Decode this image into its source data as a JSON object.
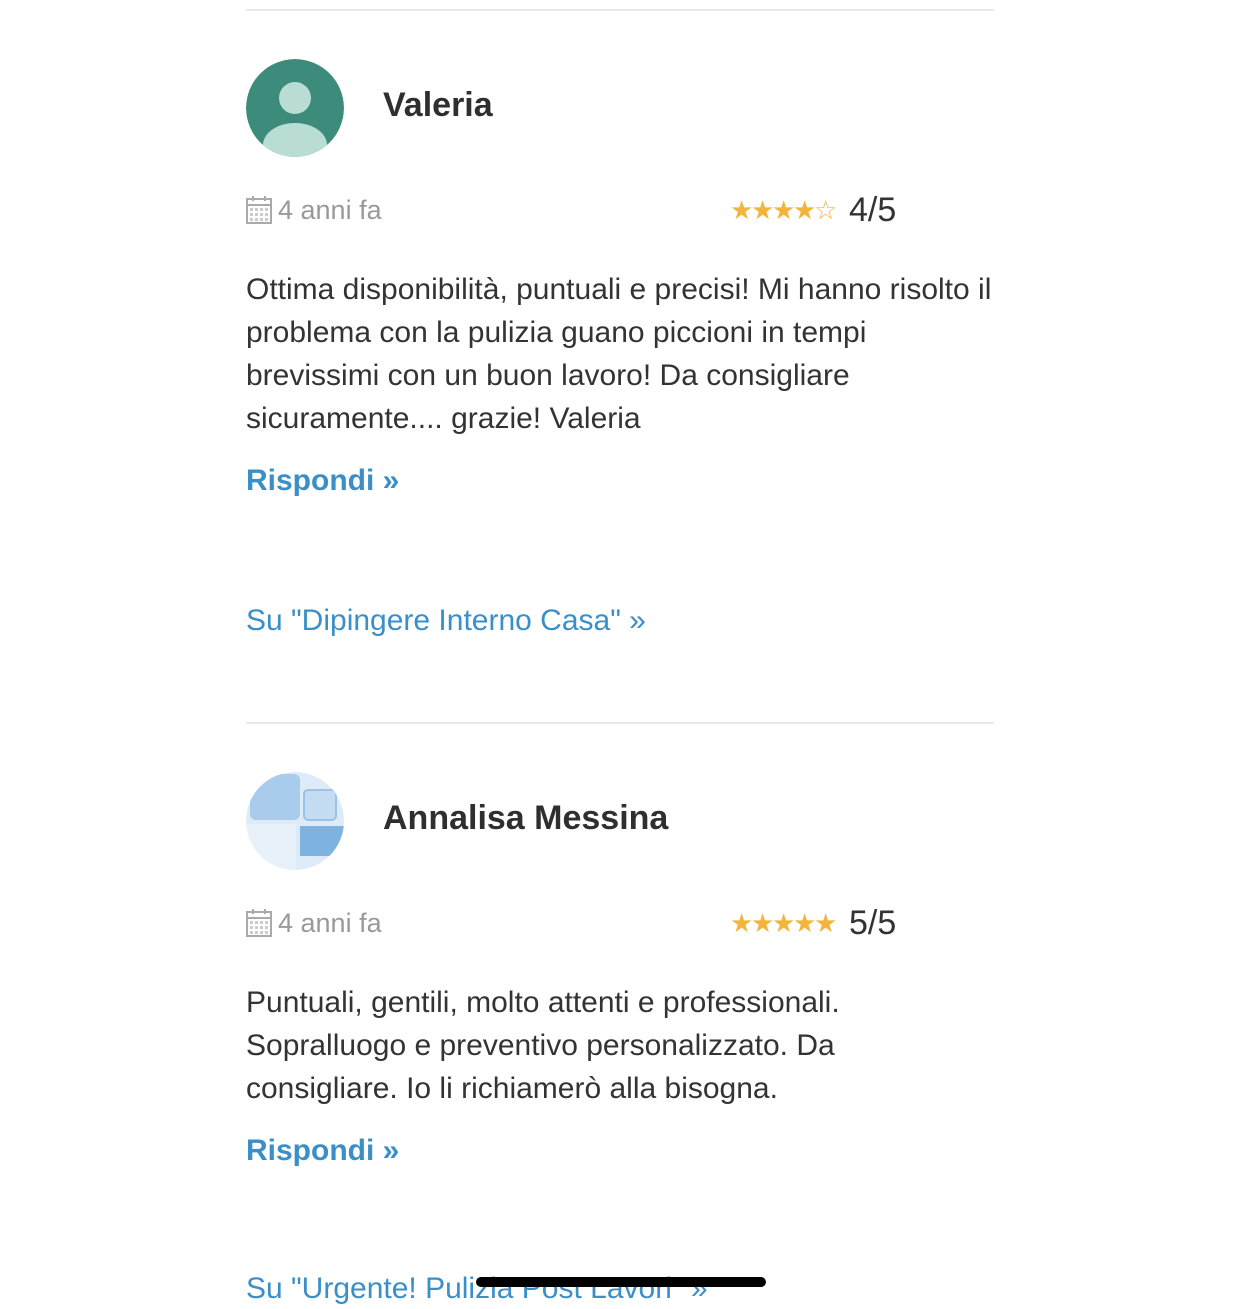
{
  "reviews": [
    {
      "reviewer": "Valeria",
      "avatar_icon": "default-user-avatar-icon",
      "date": "4 anni fa",
      "rating_value": 4,
      "rating_max": 5,
      "rating_text": "4/5",
      "body": "Ottima disponibilità, puntuali e precisi! Mi hanno risolto il problema con la pulizia guano piccioni in tempi brevissimi con un buon lavoro! Da consigliare sicuramente.... grazie! Valeria",
      "reply_label": "Rispondi »",
      "service_link": "Su \"Dipingere Interno Casa\"  »"
    },
    {
      "reviewer": "Annalisa Messina",
      "avatar_icon": "pattern-avatar-icon",
      "date": "4 anni fa",
      "rating_value": 5,
      "rating_max": 5,
      "rating_text": "5/5",
      "body": "Puntuali, gentili, molto attenti e professionali. Sopralluogo e preventivo personalizzato. Da consigliare. Io li richiamerò alla bisogna.",
      "reply_label": "Rispondi »",
      "service_link": "Su \"Urgente! Pulizia Post Lavori\"  »"
    }
  ],
  "colors": {
    "link": "#3b8fc8",
    "star": "#f2b53b",
    "avatar_green": "#3d8b7a",
    "avatar_green_light": "#b9ddd4",
    "muted_text": "#999999"
  }
}
